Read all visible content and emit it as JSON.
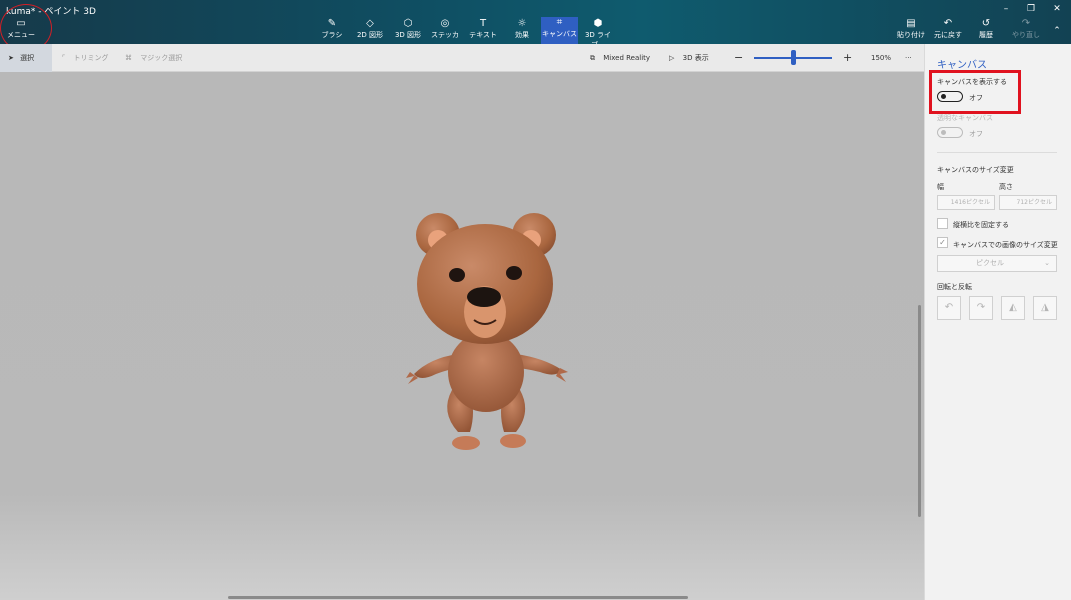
{
  "app": {
    "title": "kuma* - ペイント 3D"
  },
  "menu": {
    "label": "メニュー",
    "icon": "folder-icon"
  },
  "tools": [
    {
      "label": "ブラシ",
      "icon": "brush-icon"
    },
    {
      "label": "2D 図形",
      "icon": "shapes-2d-icon"
    },
    {
      "label": "3D 図形",
      "icon": "cube-icon"
    },
    {
      "label": "ステッカー",
      "icon": "sticker-icon"
    },
    {
      "label": "テキスト",
      "icon": "text-icon"
    },
    {
      "label": "効果",
      "icon": "effects-icon"
    },
    {
      "label": "キャンバス",
      "icon": "canvas-icon",
      "active": true
    },
    {
      "label": "3D ライブ...",
      "icon": "library-3d-icon"
    }
  ],
  "right_tools": [
    {
      "label": "貼り付け",
      "icon": "paste-icon"
    },
    {
      "label": "元に戻す",
      "icon": "undo-icon"
    },
    {
      "label": "履歴",
      "icon": "history-icon"
    },
    {
      "label": "やり直し",
      "icon": "redo-icon",
      "disabled": true
    }
  ],
  "subbar": {
    "select": "選択",
    "crop": "トリミング",
    "magic_select": "マジック選択",
    "mixed_reality": "Mixed Reality",
    "view_3d": "3D 表示",
    "zoom_minus": "−",
    "zoom_plus": "+",
    "zoom": "150%",
    "more": "···",
    "zoom_level_fraction": 0.5
  },
  "panel": {
    "title": "キャンバス",
    "show_canvas_label": "キャンバスを表示する",
    "show_canvas_state": "オフ",
    "transparent_canvas_label": "透明なキャンバス",
    "transparent_canvas_state": "オフ",
    "resize_title": "キャンバスのサイズ変更",
    "width_label": "幅",
    "height_label": "高さ",
    "width_value": "1416ピクセル",
    "height_value": "712ピクセル",
    "lock_ratio_label": "縦横比を固定する",
    "resize_image_label": "キャンバスでの画像のサイズ変更",
    "unit": "ピクセル",
    "rotate_title": "回転と反転"
  },
  "colors": {
    "accent": "#2f5fc2",
    "highlight": "#e0121f",
    "bear_body": "#b06a4a"
  }
}
